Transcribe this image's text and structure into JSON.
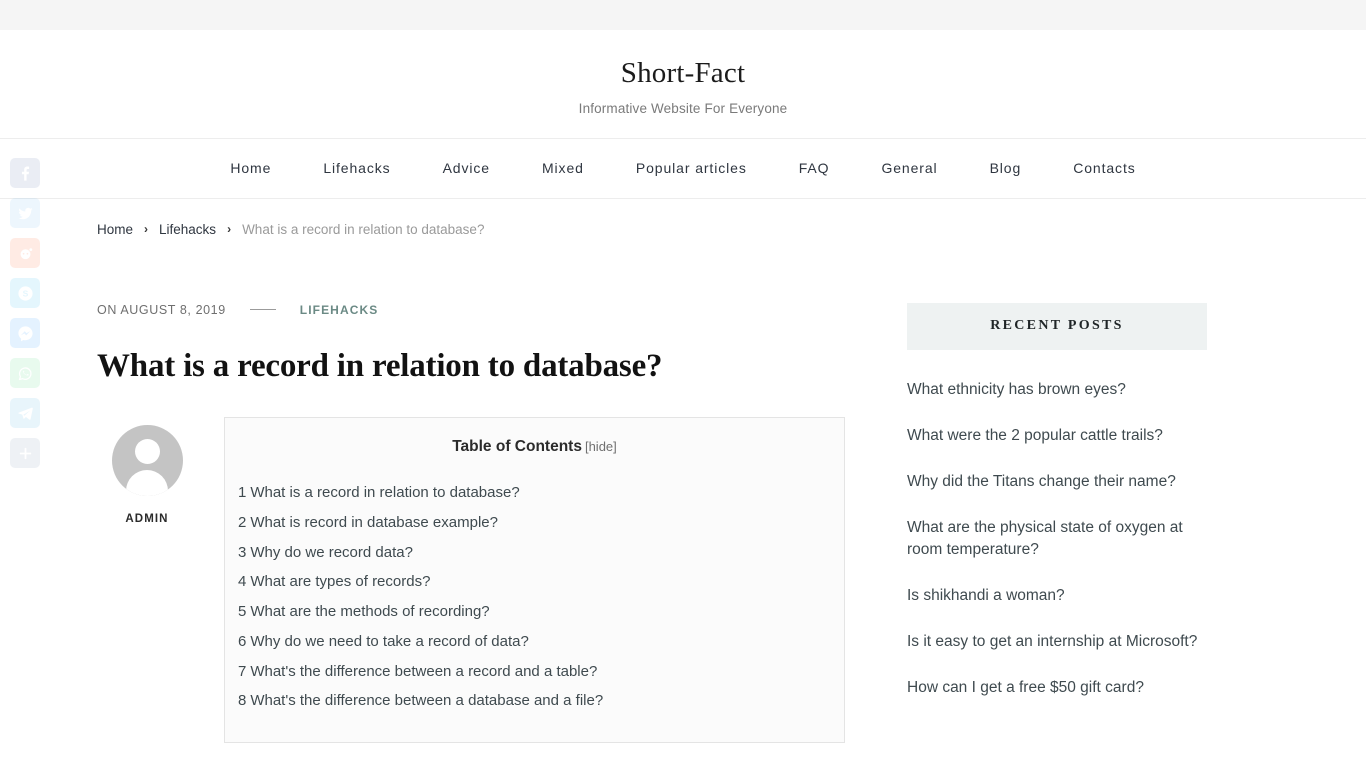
{
  "site": {
    "title": "Short-Fact",
    "tagline": "Informative Website For Everyone"
  },
  "nav": {
    "items": [
      {
        "label": "Home"
      },
      {
        "label": "Lifehacks"
      },
      {
        "label": "Advice"
      },
      {
        "label": "Mixed"
      },
      {
        "label": "Popular articles"
      },
      {
        "label": "FAQ"
      },
      {
        "label": "General"
      },
      {
        "label": "Blog"
      },
      {
        "label": "Contacts"
      }
    ]
  },
  "breadcrumb": {
    "separator": "›",
    "items": [
      {
        "label": "Home",
        "current": false
      },
      {
        "label": "Lifehacks",
        "current": false
      },
      {
        "label": "What is a record in relation to database?",
        "current": true
      }
    ]
  },
  "post": {
    "meta": {
      "date": "ON AUGUST 8, 2019",
      "category": "LIFEHACKS"
    },
    "title": "What is a record in relation to database?",
    "author": {
      "name": "ADMIN",
      "avatar_icon": "user-avatar-icon"
    }
  },
  "toc": {
    "title": "Table of Contents",
    "toggle_label": "[hide]",
    "items": [
      {
        "num": "1",
        "text": "What is a record in relation to database?"
      },
      {
        "num": "2",
        "text": "What is record in database example?"
      },
      {
        "num": "3",
        "text": "Why do we record data?"
      },
      {
        "num": "4",
        "text": "What are types of records?"
      },
      {
        "num": "5",
        "text": "What are the methods of recording?"
      },
      {
        "num": "6",
        "text": "Why do we need to take a record of data?"
      },
      {
        "num": "7",
        "text": "What's the difference between a record and a table?"
      },
      {
        "num": "8",
        "text": "What's the difference between a database and a file?"
      }
    ]
  },
  "sidebar": {
    "recent_posts": {
      "title": "Recent Posts",
      "items": [
        {
          "text": "What ethnicity has brown eyes?"
        },
        {
          "text": "What were the 2 popular cattle trails?"
        },
        {
          "text": "Why did the Titans change their name?"
        },
        {
          "text": "What are the physical state of oxygen at room temperature?"
        },
        {
          "text": "Is shikhandi a woman?"
        },
        {
          "text": "Is it easy to get an internship at Microsoft?"
        },
        {
          "text": "How can I get a free $50 gift card?"
        }
      ]
    }
  },
  "social_share": {
    "items": [
      {
        "name": "facebook-icon",
        "glyph": "f"
      },
      {
        "name": "twitter-icon",
        "glyph": "t"
      },
      {
        "name": "reddit-icon",
        "glyph": "r"
      },
      {
        "name": "skype-icon",
        "glyph": "S"
      },
      {
        "name": "messenger-icon",
        "glyph": "m"
      },
      {
        "name": "whatsapp-icon",
        "glyph": "w"
      },
      {
        "name": "telegram-icon",
        "glyph": "T"
      },
      {
        "name": "share-icon",
        "glyph": "+"
      }
    ]
  },
  "colors": {
    "accent": "#6b8a85",
    "text": "#3f4a4f",
    "title": "#121212",
    "widget_bg": "#eef2f2",
    "toc_bg": "#fbfbfb"
  }
}
